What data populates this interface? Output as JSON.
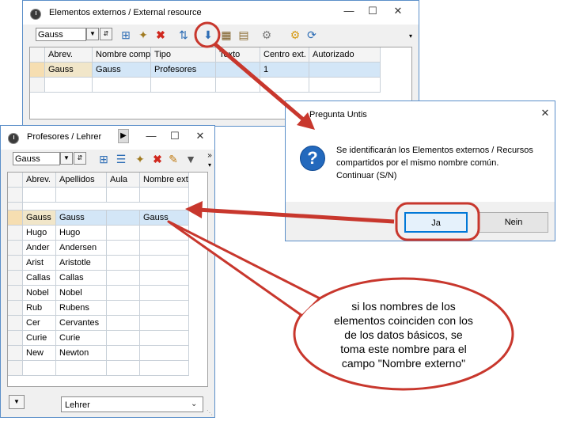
{
  "ext_window": {
    "title": "Elementos externos / External resource",
    "combo_value": "Gauss",
    "columns": [
      "Abrev.",
      "Nombre comp",
      "Tipo",
      "Texto",
      "Centro ext.",
      "Autorizado"
    ],
    "rows": [
      [
        "Gauss",
        "Gauss",
        "Profesores",
        "",
        "1",
        ""
      ]
    ]
  },
  "prof_window": {
    "title": "Profesores / Lehrer",
    "combo_value": "Gauss",
    "columns": [
      "Abrev.",
      "Apellidos",
      "Aula",
      "Nombre ext"
    ],
    "rows": [
      [
        "Gauss",
        "Gauss",
        "",
        "Gauss"
      ],
      [
        "Hugo",
        "Hugo",
        "",
        ""
      ],
      [
        "Ander",
        "Andersen",
        "",
        ""
      ],
      [
        "Arist",
        "Aristotle",
        "",
        ""
      ],
      [
        "Callas",
        "Callas",
        "",
        ""
      ],
      [
        "Nobel",
        "Nobel",
        "",
        ""
      ],
      [
        "Rub",
        "Rubens",
        "",
        ""
      ],
      [
        "Cer",
        "Cervantes",
        "",
        ""
      ],
      [
        "Curie",
        "Curie",
        "",
        ""
      ],
      [
        "New",
        "Newton",
        "",
        ""
      ]
    ],
    "bottom_select": "Lehrer"
  },
  "dialog": {
    "title": "Pregunta Untis",
    "message_line1": "Se identificarán los Elementos externos / Recursos",
    "message_line2": "compartidos por el mismo nombre común.",
    "message_line3": "Continuar (S/N)",
    "yes_label": "Ja",
    "no_label": "Nein"
  },
  "callout": {
    "line1": "si los nombres de los",
    "line2": "elementos coinciden con los",
    "line3": "de los datos básicos, se",
    "line4": "toma este nombre para el",
    "line5": "campo \"Nombre externo\""
  },
  "colors": {
    "accent": "#c8372d",
    "window_border": "#5b8fc9",
    "selection": "#d3e6f7",
    "row_marker": "#f6deb1"
  }
}
